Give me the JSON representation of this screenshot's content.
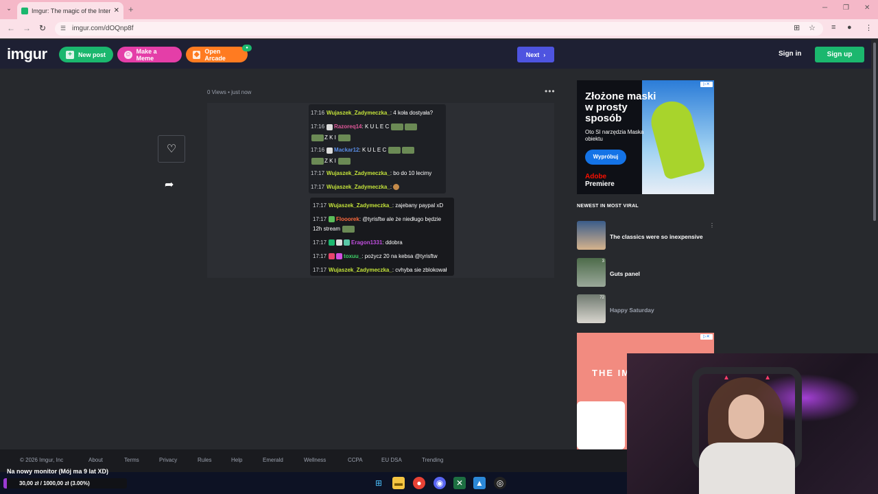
{
  "browser": {
    "tab_title": "Imgur: The magic of the Interne",
    "url": "imgur.com/dOQnp8f"
  },
  "header": {
    "logo": "imgur",
    "new_post": "New post",
    "make_meme": "Make a Meme",
    "open_arcade": "Open Arcade",
    "next": "Next",
    "sign_in": "Sign in",
    "sign_up": "Sign up"
  },
  "post": {
    "meta": "0 Views • just now",
    "chat_top": [
      {
        "time": "17:16",
        "user": "Wujaszek_Zadymeczka_",
        "msg": ": 4 koła dostyała?"
      },
      {
        "time": "17:16",
        "user": "Razoreq14",
        "msg": ": K  U  L  E  C"
      },
      {
        "time": "",
        "user": "",
        "msg": "Z  K  I"
      },
      {
        "time": "17:16",
        "user": "Mackar12",
        "msg": ": K  U  L  E  C"
      },
      {
        "time": "",
        "user": "",
        "msg": "Z  K  I"
      },
      {
        "time": "17:17",
        "user": "Wujaszek_Zadymeczka_",
        "msg": ": bo do 10 lecimy"
      },
      {
        "time": "17:17",
        "user": "Wujaszek_Zadymeczka_",
        "msg": ":"
      }
    ],
    "chat_bottom": [
      {
        "time": "17:17",
        "user": "Wujaszek_Zadymeczka_",
        "msg": ": zajebany paypal xD"
      },
      {
        "time": "17:17",
        "user": "Flooorek",
        "msg": ": @tyrisftw ale że niedługo będzie"
      },
      {
        "time": "",
        "user": "",
        "msg": "12h stream"
      },
      {
        "time": "17:17",
        "user": "Eragon1331",
        "msg": ": ddobra"
      },
      {
        "time": "17:17",
        "user": "toxuu_",
        "msg": ": pożycz 20 na kebsa @tyrisftw"
      },
      {
        "time": "17:17",
        "user": "Wujaszek_Zadymeczka_",
        "msg": ": cvhyba sie zblokował"
      }
    ]
  },
  "ad1": {
    "headline": "Złożone maski w prosty sposób",
    "sub": "Oto SI narzędzia Maska obiektu",
    "button": "Wypróbuj",
    "brand1": "Adobe",
    "brand2": "Premiere"
  },
  "viral": {
    "heading": "NEWEST IN MOST VIRAL",
    "items": [
      {
        "title": "The classics were so inexpensive",
        "count": ""
      },
      {
        "title": "Guts panel",
        "count": "3"
      },
      {
        "title": "Happy Saturday",
        "count": "72"
      }
    ]
  },
  "ad2": {
    "text": "THE IM"
  },
  "footer": {
    "links": [
      "© 2026 Imgur, Inc",
      "About",
      "Terms",
      "Privacy",
      "Rules",
      "Help",
      "Emerald",
      "Wellness",
      "CCPA",
      "EU DSA",
      "Trending"
    ]
  },
  "stream": {
    "goal_text": "Na nowy monitor (Mój ma 9 lat XD)",
    "donation": "30,00 zł  /  1000,00 zł  (3.00%)",
    "progress_pct": 3
  },
  "colors": {
    "green": "#1bb76e",
    "pink": "#e43ea8",
    "orange": "#ff7b21",
    "next_blue": "#4e54e0"
  }
}
